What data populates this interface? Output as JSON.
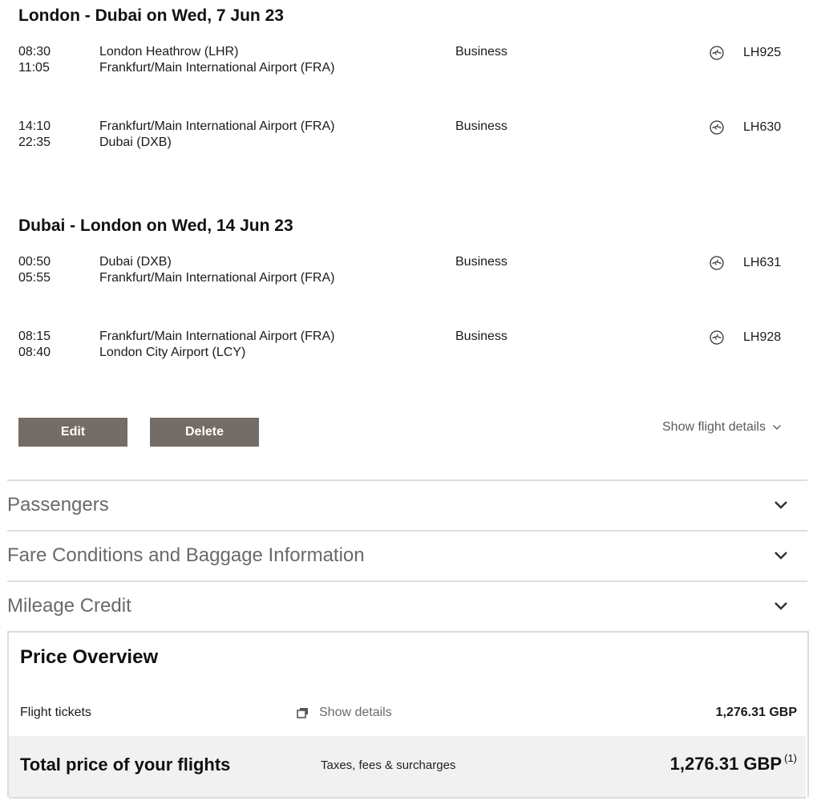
{
  "outbound": {
    "title": "London - Dubai on Wed, 7 Jun 23",
    "segments": [
      {
        "dep_time": "08:30",
        "arr_time": "11:05",
        "from": "London Heathrow (LHR)",
        "to": "Frankfurt/Main International Airport (FRA)",
        "cabin": "Business",
        "flight": "LH925",
        "icon": "airline-crane-logo"
      },
      {
        "dep_time": "14:10",
        "arr_time": "22:35",
        "from": "Frankfurt/Main International Airport (FRA)",
        "to": "Dubai (DXB)",
        "cabin": "Business",
        "flight": "LH630",
        "icon": "airline-crane-logo"
      }
    ]
  },
  "inbound": {
    "title": "Dubai - London on Wed, 14 Jun 23",
    "segments": [
      {
        "dep_time": "00:50",
        "arr_time": "05:55",
        "from": "Dubai (DXB)",
        "to": "Frankfurt/Main International Airport (FRA)",
        "cabin": "Business",
        "flight": "LH631",
        "icon": "airline-crane-logo"
      },
      {
        "dep_time": "08:15",
        "arr_time": "08:40",
        "from": "Frankfurt/Main International Airport (FRA)",
        "to": "London City Airport (LCY)",
        "cabin": "Business",
        "flight": "LH928",
        "icon": "airline-crane-logo"
      }
    ]
  },
  "actions": {
    "edit_label": "Edit",
    "delete_label": "Delete",
    "show_flight_details": "Show flight details"
  },
  "accordions": {
    "passengers": "Passengers",
    "fare_conditions": "Fare Conditions and Baggage Information",
    "mileage": "Mileage Credit"
  },
  "price": {
    "title": "Price Overview",
    "tickets_label": "Flight tickets",
    "show_details": "Show details",
    "tickets_amount": "1,276.31 GBP",
    "total_label": "Total price of your flights",
    "total_note": "Taxes, fees & surcharges",
    "total_amount": "1,276.31 GBP",
    "footnote": "(1)"
  },
  "colors": {
    "button_bg": "#746c66",
    "accordion_text": "#6e6866",
    "total_band_bg": "#f1f1f1"
  }
}
